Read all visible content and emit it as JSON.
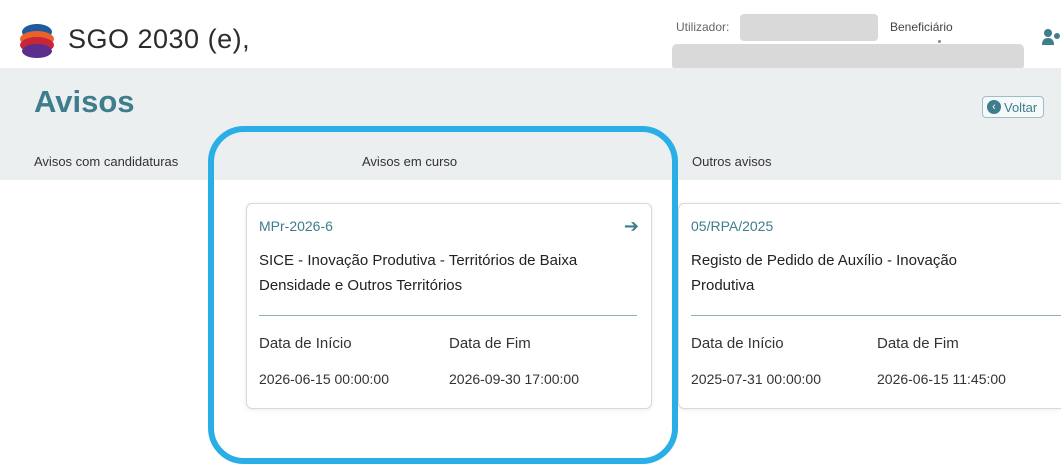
{
  "header": {
    "app_title": "SGO 2030 (e),",
    "user_label": "Utilizador:",
    "beneficiary_label": "Beneficiário"
  },
  "page": {
    "title": "Avisos",
    "back_label": "Voltar"
  },
  "tabs": [
    {
      "label": "Avisos com candidaturas"
    },
    {
      "label": "Avisos em curso"
    },
    {
      "label": "Outros avisos"
    }
  ],
  "cards": [
    {
      "code": "MPr-2026-6",
      "title": "SICE - Inovação Produtiva - Territórios de Baixa Densidade e Outros Territórios",
      "start_label": "Data de Início",
      "end_label": "Data de Fim",
      "start_value": "2026-06-15 00:00:00",
      "end_value": "2026-09-30 17:00:00"
    },
    {
      "code": "05/RPA/2025",
      "title": "Registo de Pedido de Auxílio - Inovação Produtiva",
      "start_label": "Data de Início",
      "end_label": "Data de Fim",
      "start_value": "2025-07-31 00:00:00",
      "end_value": "2026-06-15 11:45:00"
    }
  ],
  "colors": {
    "accent": "#3e7d8c",
    "highlight": "#29aee6",
    "band": "#ebeff0"
  },
  "icons": [
    "logo-icon",
    "user-icon",
    "arrow-right-icon",
    "back-circle-icon"
  ]
}
